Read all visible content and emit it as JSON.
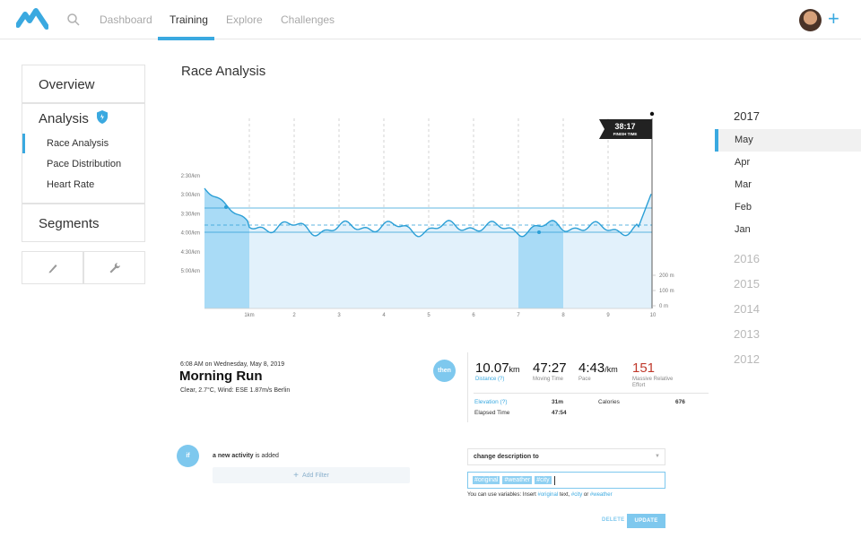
{
  "nav": {
    "items": [
      {
        "label": "Dashboard",
        "active": false
      },
      {
        "label": "Training",
        "active": true
      },
      {
        "label": "Explore",
        "active": false
      },
      {
        "label": "Challenges",
        "active": false
      }
    ],
    "accent_color": "#3aa9e0"
  },
  "sidebar": {
    "overview": "Overview",
    "analysis": "Analysis",
    "analysis_items": [
      "Race Analysis",
      "Pace Distribution",
      "Heart Rate"
    ],
    "segments": "Segments",
    "tools": [
      "pencil-icon",
      "wrench-icon"
    ]
  },
  "page": {
    "title": "Race Analysis"
  },
  "chart_data": {
    "type": "area",
    "pace_ticks": [
      "2:30/km",
      "3:00/km",
      "3:30/km",
      "4:00/km",
      "4:30/km",
      "5:00/km"
    ],
    "elevation_ticks": [
      "200 m",
      "100 m",
      "0 m"
    ],
    "x_ticks": [
      "1km",
      "2",
      "3",
      "4",
      "5",
      "6",
      "7",
      "8",
      "9",
      "10"
    ],
    "finish_time": "38:17",
    "finish_label": "FINISH TIME",
    "highlighted_segments_km": [
      [
        0,
        1
      ],
      [
        7,
        8
      ]
    ]
  },
  "calendar": {
    "current_year": "2017",
    "months": [
      "May",
      "Apr",
      "Mar",
      "Feb",
      "Jan"
    ],
    "selected_month": "May",
    "past_years": [
      "2016",
      "2015",
      "2014",
      "2013",
      "2012"
    ]
  },
  "activity": {
    "meta": "6:08 AM on Wednesday, May 8, 2019",
    "name": "Morning Run",
    "conditions": "Clear, 2.7°C, Wind: ESE 1.87m/s  Berlin",
    "then_badge": "then",
    "if_badge": "if",
    "stats": {
      "distance": {
        "value": "10.07",
        "unit": "km",
        "label": "Distance (?)"
      },
      "moving_time": {
        "value": "47:27",
        "label": "Moving Time"
      },
      "pace": {
        "value": "4:43",
        "unit": "/km",
        "label": "Pace"
      },
      "effort": {
        "value": "151",
        "label": "Massive Relative Effort",
        "color": "#c0392b"
      }
    },
    "elevation_label": "Elevation (?)",
    "elevation_value": "31m",
    "calories_label": "Calories",
    "calories_value": "676",
    "elapsed_label": "Elapsed Time",
    "elapsed_value": "47:54"
  },
  "rule": {
    "trigger_prefix": "a new activity",
    "trigger_suffix": "is added",
    "add_filter": "Add Filter",
    "action": "change description to",
    "tags": [
      "#original",
      "#weather",
      "#city"
    ],
    "hint_pre": "You can use variables: Insert",
    "hint_var1": "#original",
    "hint_mid": "text,",
    "hint_var2": "#city",
    "hint_or": "or",
    "hint_var3": "#weather",
    "delete": "DELETE",
    "update": "UPDATE"
  }
}
